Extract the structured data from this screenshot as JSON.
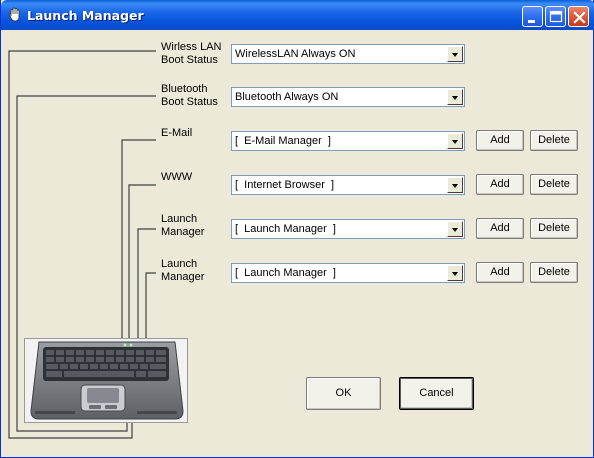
{
  "window": {
    "title": "Launch Manager"
  },
  "rows": [
    {
      "label_line1": "Wirless LAN",
      "label_line2": "Boot Status",
      "value": "WirelessLAN Always ON"
    },
    {
      "label_line1": "Bluetooth",
      "label_line2": "Boot Status",
      "value": "Bluetooth Always ON"
    },
    {
      "label_line1": "E-Mail",
      "label_line2": "",
      "value": "[  E-Mail Manager  ]",
      "add": "Add",
      "delete": "Delete"
    },
    {
      "label_line1": "WWW",
      "label_line2": "",
      "value": "[  Internet Browser  ]",
      "add": "Add",
      "delete": "Delete"
    },
    {
      "label_line1": "Launch",
      "label_line2": "Manager",
      "value": "[  Launch Manager  ]",
      "add": "Add",
      "delete": "Delete"
    },
    {
      "label_line1": "Launch",
      "label_line2": "Manager",
      "value": "[  Launch Manager  ]",
      "add": "Add",
      "delete": "Delete"
    }
  ],
  "buttons": {
    "ok": "OK",
    "cancel": "Cancel"
  },
  "colors": {
    "titlebar": "#0855DD",
    "face": "#ECE9D8",
    "close": "#DB5A3B"
  }
}
